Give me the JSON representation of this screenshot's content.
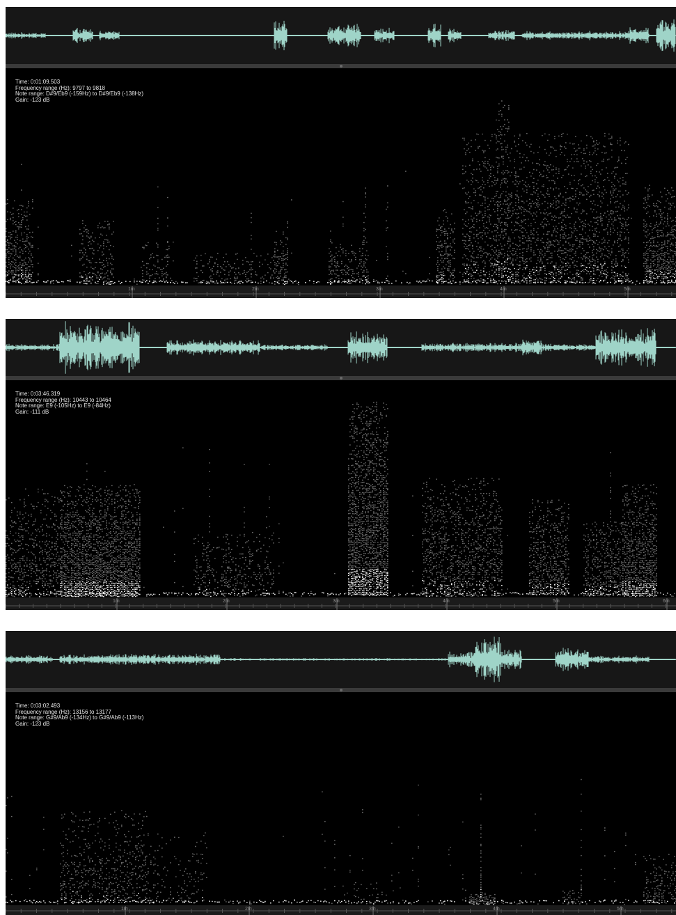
{
  "panels": [
    {
      "time": "Time: 0:01:09.503",
      "frequency_range": "Frequency range (Hz): 9797 to 9818",
      "note_range": "Note range: D#9/Eb9 (-159Hz) to D#9/Eb9 (-138Hz)",
      "gain": "Gain: -123 dB",
      "ruler_labels": [
        "1m",
        "2m",
        "3m",
        "4m",
        "5m"
      ]
    },
    {
      "time": "Time: 0:03:46.319",
      "frequency_range": "Frequency range (Hz): 10443 to 10464",
      "note_range": "Note range: E9 (-105Hz) to E9 (-84Hz)",
      "gain": "Gain: -111 dB",
      "ruler_labels": [
        "1m",
        "2m",
        "3m",
        "4m",
        "5m",
        "6m"
      ]
    },
    {
      "time": "Time: 0:03:02.493",
      "frequency_range": "Frequency range (Hz): 13156 to 13177",
      "note_range": "Note range: G#9/Ab9 (-134Hz) to G#9/Ab9 (-113Hz)",
      "gain": "Gain: -123 dB",
      "ruler_labels": [
        "1m",
        "2m",
        "3m",
        "4m",
        "5m"
      ]
    }
  ],
  "colors": {
    "waveform": "#9fd4c8",
    "background": "#000000",
    "waveform_background": "#171717",
    "ruler_background": "#1b1b1b"
  }
}
